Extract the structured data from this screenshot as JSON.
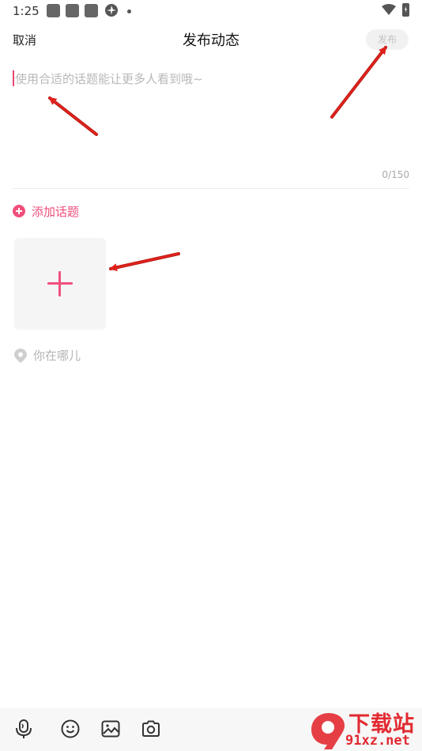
{
  "status_bar": {
    "time": "1:25"
  },
  "header": {
    "cancel_label": "取消",
    "title": "发布动态",
    "publish_label": "发布"
  },
  "compose": {
    "placeholder": "使用合适的话题能让更多人看到哦~",
    "counter": "0/150"
  },
  "add_topic": {
    "label": "添加话题"
  },
  "location": {
    "label": "你在哪儿"
  },
  "toolbar": {
    "icons": [
      "microphone-icon",
      "emoji-icon",
      "image-icon",
      "camera-icon"
    ]
  },
  "watermark": {
    "top_text": "下载站",
    "bottom_text": "91xz.net"
  },
  "colors": {
    "accent": "#f0507c",
    "annotation_arrow": "#e0221c"
  }
}
